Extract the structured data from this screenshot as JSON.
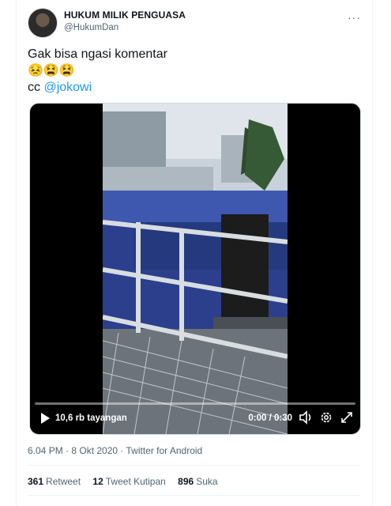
{
  "tweet": {
    "display_name": "HUKUM MILIK PENGUASA",
    "handle": "@HukumDan",
    "more_icon": "···",
    "line1": "Gak bisa ngasi komentar",
    "emojis": "😣😫😫",
    "cc": "cc ",
    "mention": "@jokowi"
  },
  "video": {
    "views": "10,6 rb tayangan",
    "time": "0:00 / 0:30",
    "progress": 0
  },
  "meta": {
    "timestamp": "6.04 PM · 8 Okt 2020 · Twitter for Android"
  },
  "stats": {
    "retweets_count": "361",
    "retweets_label": "Retweet",
    "quotes_count": "12",
    "quotes_label": "Tweet Kutipan",
    "likes_count": "896",
    "likes_label": "Suka"
  },
  "colors": {
    "link": "#1d9bf0",
    "secondary_text": "#536471",
    "divider": "#eff3f4"
  }
}
